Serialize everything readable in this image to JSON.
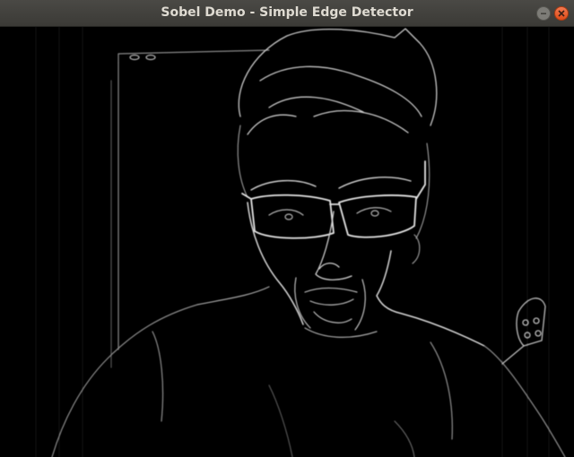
{
  "window": {
    "title": "Sobel Demo - Simple Edge Detector",
    "controls": {
      "minimize_icon": "minimize-icon",
      "close_icon": "close-icon"
    }
  },
  "colors": {
    "titlebar": "#3e3d39",
    "title_text": "#dfdbd2",
    "close_button": "#e95420",
    "canvas_background": "#000000",
    "edge_stroke": "#d9d9d9"
  }
}
